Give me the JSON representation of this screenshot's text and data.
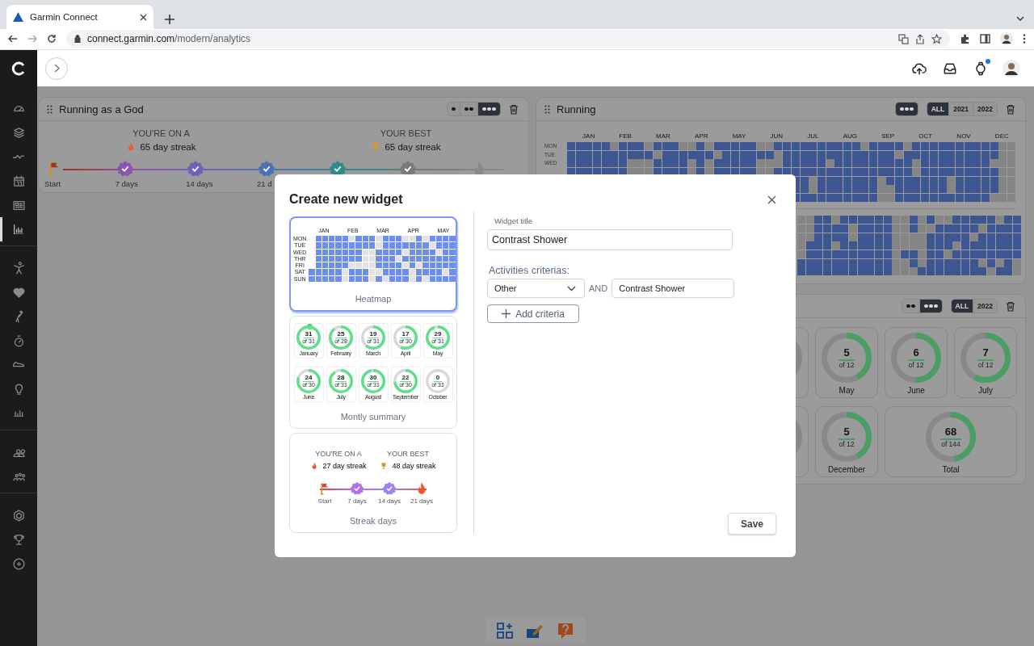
{
  "browser": {
    "tab": {
      "title": "Garmin Connect"
    },
    "url": {
      "host": "connect.garmin.com",
      "path": "/modern/analytics"
    }
  },
  "sidebar": {
    "groups": [
      [
        {
          "kind": "gauge",
          "selected": false
        },
        {
          "kind": "layers",
          "selected": false
        },
        {
          "kind": "pulse",
          "selected": false
        },
        {
          "kind": "calendar",
          "selected": false
        },
        {
          "kind": "news",
          "selected": false
        },
        {
          "kind": "chart",
          "selected": true
        }
      ],
      [
        {
          "kind": "person",
          "selected": false
        },
        {
          "kind": "heart",
          "selected": false
        },
        {
          "kind": "golf",
          "selected": false
        },
        {
          "kind": "stopwatch",
          "selected": false
        },
        {
          "kind": "shoe",
          "selected": false
        },
        {
          "kind": "bulb",
          "selected": false
        },
        {
          "kind": "bars",
          "selected": false
        }
      ],
      [
        {
          "kind": "people",
          "selected": false
        },
        {
          "kind": "group",
          "selected": false
        }
      ],
      [
        {
          "kind": "hexagon",
          "selected": false
        },
        {
          "kind": "trophy",
          "selected": false
        },
        {
          "kind": "target",
          "selected": false
        }
      ]
    ]
  },
  "header": {
    "actions": [
      {
        "kind": "upload",
        "badge": false
      },
      {
        "kind": "inbox",
        "badge": false
      },
      {
        "kind": "watch",
        "badge": true
      },
      {
        "kind": "avatar",
        "badge": false
      }
    ]
  },
  "widgets": [
    {
      "kind": "streak",
      "title": "Running as a God",
      "sizes": [
        {
          "kind": "single",
          "selected": false
        },
        {
          "kind": "double",
          "selected": false
        },
        {
          "kind": "triple",
          "selected": true
        }
      ],
      "current_label": "YOU'RE ON A",
      "current": "65 day streak",
      "best_label": "YOUR BEST",
      "best": "65 day streak",
      "milestones": [
        {
          "kind": "flag",
          "label": "Start",
          "color": "#a8301f"
        },
        {
          "kind": "badge",
          "label": "7 days",
          "color": "#8a55b0"
        },
        {
          "kind": "badge",
          "label": "14 days",
          "color": "#7060b8"
        },
        {
          "kind": "badge",
          "label": "21 d",
          "color": "#4a72b0"
        },
        {
          "kind": "badge",
          "color": "#2f8a8a"
        },
        {
          "kind": "badge",
          "color": "#7a7a7a"
        },
        {
          "kind": "fire",
          "color": "#8a8a8a"
        }
      ]
    },
    {
      "kind": "heatmap",
      "title": "Running",
      "sizes": [
        {
          "kind": "triple",
          "selected": true
        }
      ],
      "years": [
        {
          "label": "ALL",
          "selected": true
        },
        {
          "label": "2021",
          "selected": false
        },
        {
          "label": "2022",
          "selected": false
        }
      ],
      "days": [
        "MON",
        "TUE",
        "WED"
      ],
      "months": [
        "JAN",
        "FEB",
        "MAR",
        "APR",
        "MAY",
        "JUN",
        "JUL",
        "AUG",
        "SEP",
        "OCT",
        "NOV",
        "DEC"
      ],
      "grids": [
        {
          "rows": [
            [
              true,
              true,
              true,
              true,
              true,
              false,
              true,
              true,
              true,
              false,
              true,
              true,
              true,
              false,
              false,
              true,
              false,
              true,
              true,
              true,
              true,
              true,
              false,
              false,
              true,
              true,
              true,
              true,
              true,
              true,
              true,
              true,
              true,
              true,
              false,
              true,
              true,
              true,
              true,
              false,
              true,
              true,
              true,
              true,
              true,
              true,
              true,
              true,
              true,
              true,
              false,
              false
            ],
            [
              true,
              true,
              true,
              true,
              true,
              true,
              true,
              true,
              true,
              true,
              false,
              true,
              true,
              true,
              true,
              true,
              true,
              false,
              true,
              true,
              true,
              true,
              true,
              true,
              false,
              true,
              true,
              true,
              true,
              true,
              true,
              true,
              true,
              true,
              true,
              true,
              true,
              true,
              false,
              true,
              true,
              true,
              true,
              true,
              true,
              true,
              true,
              true,
              true,
              true,
              false,
              false
            ],
            [
              true,
              true,
              true,
              true,
              true,
              true,
              true,
              false,
              false,
              false,
              true,
              true,
              true,
              true,
              false,
              true,
              false,
              true,
              true,
              true,
              true,
              true,
              false,
              false,
              false,
              true,
              true,
              true,
              true,
              true,
              false,
              true,
              true,
              true,
              true,
              true,
              true,
              true,
              true,
              true,
              false,
              true,
              true,
              true,
              true,
              true,
              true,
              true,
              true,
              false,
              false,
              false
            ],
            [
              true,
              true,
              true,
              true,
              true,
              true,
              true,
              false,
              false,
              false,
              true,
              true,
              true,
              true,
              false,
              true,
              false,
              true,
              true,
              true,
              true,
              true,
              false,
              false,
              true,
              true,
              true,
              true,
              true,
              true,
              true,
              true,
              true,
              true,
              true,
              true,
              true,
              true,
              true,
              true,
              false,
              true,
              true,
              true,
              true,
              true,
              true,
              true,
              true,
              true,
              false,
              false
            ],
            [
              true,
              true,
              false,
              true,
              true,
              true,
              true,
              true,
              true,
              true,
              false,
              true,
              true,
              true,
              true,
              true,
              true,
              true,
              false,
              true,
              true,
              true,
              true,
              true,
              false,
              false
            ],
            [
              true,
              true,
              false,
              true,
              true,
              true,
              true,
              true,
              true,
              true,
              false,
              false,
              true,
              true,
              true,
              true,
              true,
              true,
              false,
              true,
              true,
              true,
              true,
              true,
              false,
              false
            ],
            [
              true,
              true,
              true,
              true,
              true,
              true,
              true,
              true,
              true,
              true,
              false,
              false,
              true,
              true,
              true,
              true,
              true,
              true,
              true,
              true,
              true,
              true,
              true,
              false,
              false,
              false
            ]
          ]
        },
        {
          "rows": [
            [
              false,
              false,
              true,
              true,
              false,
              true,
              true,
              true,
              true,
              true,
              true,
              false,
              false,
              true,
              false,
              true,
              false,
              false,
              true,
              true,
              true,
              true,
              true,
              false,
              true,
              true
            ],
            [
              false,
              false,
              true,
              true,
              true,
              true,
              false,
              true,
              true,
              true,
              true,
              false,
              false,
              true,
              false,
              false,
              true,
              true,
              true,
              true,
              true,
              false,
              true,
              true,
              true,
              true
            ],
            [
              false,
              false,
              true,
              true,
              true,
              true,
              false,
              true,
              true,
              true,
              true,
              false,
              false,
              false,
              false,
              true,
              true,
              true,
              true,
              true,
              false,
              true,
              true,
              true,
              true,
              true
            ],
            [
              false,
              true,
              true,
              true,
              false,
              true,
              true,
              true,
              true,
              true,
              true,
              false,
              false,
              false,
              false,
              true,
              true,
              true,
              false,
              true,
              true,
              true,
              true,
              true,
              true,
              true
            ],
            [
              false,
              true,
              true,
              true,
              true,
              true,
              true,
              true,
              true,
              true,
              true,
              false,
              true,
              true,
              false,
              true,
              true,
              false,
              true,
              true,
              true,
              true,
              true,
              true,
              true,
              true
            ],
            [
              true,
              true,
              true,
              true,
              true,
              true,
              true,
              true,
              true,
              true,
              true,
              false,
              false,
              true,
              false,
              true,
              true,
              true,
              true,
              true,
              true,
              false,
              true,
              false,
              true,
              false
            ],
            [
              true,
              true,
              true,
              true,
              true,
              true,
              true,
              true,
              true,
              true,
              true,
              false,
              false,
              false,
              true,
              true,
              true,
              true,
              true,
              true,
              true,
              true,
              false,
              true,
              true,
              false
            ]
          ]
        }
      ]
    },
    {
      "kind": "monthly",
      "sizes": [
        {
          "kind": "double",
          "selected": false
        },
        {
          "kind": "triple",
          "selected": true
        }
      ],
      "years": [
        {
          "label": "ALL",
          "selected": true
        },
        {
          "label": "2022",
          "selected": false
        }
      ],
      "rows": [
        [
          {
            "kind": "month"
          },
          {
            "kind": "month",
            "value": "5",
            "total": "of 12",
            "label": "May",
            "level": 0.42
          },
          {
            "kind": "month",
            "value": "6",
            "total": "of 12",
            "label": "June",
            "level": 0.5
          },
          {
            "kind": "month",
            "value": "7",
            "total": "of 12",
            "label": "July",
            "level": 0.58
          }
        ],
        [
          {
            "kind": "month"
          },
          {
            "kind": "month",
            "value": "5",
            "total": "of 12",
            "label": "December",
            "level": 0.42
          },
          {
            "kind": "total",
            "value": "68",
            "total": "of 144",
            "label": "Total",
            "level": 0.47
          }
        ]
      ]
    }
  ],
  "modal": {
    "title": "Create new widget",
    "templates": [
      {
        "kind": "heatmap",
        "label": "Heatmap",
        "selected": true,
        "days": [
          "MON",
          "TUE",
          "WED",
          "THR",
          "FRI",
          "SAT",
          "SUN"
        ],
        "months": [
          "JAN",
          "FEB",
          "MAR",
          "APR",
          "MAY"
        ],
        "rows": [
          [
            null,
            true,
            true,
            true,
            true,
            true,
            false,
            true,
            true,
            true,
            false,
            true,
            true,
            true,
            false,
            false,
            true,
            false,
            true,
            true,
            true,
            true
          ],
          [
            null,
            true,
            true,
            true,
            true,
            true,
            true,
            true,
            true,
            true,
            false,
            true,
            true,
            true,
            true,
            true,
            true,
            true,
            false,
            true,
            true,
            true
          ],
          [
            null,
            true,
            true,
            true,
            true,
            true,
            true,
            true,
            false,
            false,
            true,
            true,
            true,
            true,
            false,
            true,
            true,
            true,
            true,
            false,
            true,
            true
          ],
          [
            null,
            true,
            true,
            true,
            true,
            true,
            true,
            true,
            false,
            false,
            true,
            true,
            true,
            false,
            true,
            true,
            true,
            true,
            true,
            true,
            true,
            true
          ],
          [
            null,
            true,
            true,
            true,
            true,
            true,
            false,
            false,
            false,
            false,
            true,
            true,
            true,
            true,
            false,
            true,
            false,
            true,
            true,
            true,
            true,
            true
          ],
          [
            true,
            true,
            true,
            true,
            true,
            false,
            true,
            true,
            true,
            false,
            false,
            true,
            true,
            true,
            true,
            false,
            true,
            true,
            true,
            true,
            false,
            true
          ],
          [
            true,
            true,
            true,
            true,
            true,
            false,
            true,
            true,
            true,
            false,
            true,
            false,
            true,
            true,
            true,
            false,
            true,
            false,
            true,
            true,
            true,
            true
          ]
        ]
      },
      {
        "kind": "monthly",
        "label": "Montly summary",
        "selected": false,
        "cards": [
          {
            "value": "31",
            "total": "of 31",
            "label": "January",
            "level": 1,
            "done": true
          },
          {
            "value": "25",
            "total": "of 28",
            "label": "February",
            "level": 0.89,
            "done": false
          },
          {
            "value": "19",
            "total": "of 31",
            "label": "March",
            "level": 0.61,
            "done": false
          },
          {
            "value": "17",
            "total": "of 30",
            "label": "April",
            "level": 0.57,
            "done": false
          },
          {
            "value": "29",
            "total": "of 31",
            "label": "May",
            "level": 0.94,
            "done": false
          },
          {
            "value": "24",
            "total": "of 30",
            "label": "June",
            "level": 0.8,
            "done": false
          },
          {
            "value": "28",
            "total": "of 31",
            "label": "July",
            "level": 0.9,
            "done": false
          },
          {
            "value": "30",
            "total": "of 31",
            "label": "August",
            "level": 0.97,
            "done": false
          },
          {
            "value": "22",
            "total": "of 30",
            "label": "September",
            "level": 0.73,
            "done": false
          },
          {
            "value": "0",
            "total": "of 31",
            "label": "October",
            "level": 0,
            "done": false
          }
        ]
      },
      {
        "kind": "streak",
        "label": "Streak days",
        "selected": false,
        "current_label": "YOU'RE ON A",
        "current": "27 day streak",
        "best_label": "YOUR BEST",
        "best": "48 day streak",
        "milestones": [
          {
            "kind": "flag",
            "label": "Start",
            "color": "#e2452f"
          },
          {
            "kind": "badge",
            "label": "7 days",
            "color": "#b173e6"
          },
          {
            "kind": "badge",
            "label": "14 days",
            "color": "#9a85f0"
          },
          {
            "kind": "fire",
            "label": "21 days",
            "color": "#f0582c"
          }
        ]
      }
    ],
    "title_field": {
      "label": "Widget title",
      "value": "Contrast Shower"
    },
    "criteria_label": "Activities criterias:",
    "criteria": [
      {
        "type": "Other",
        "join": "AND",
        "value": "Contrast Shower"
      }
    ],
    "add_button": "Add criteria",
    "save_button": "Save"
  },
  "toolbar": [
    {
      "kind": "widgets"
    },
    {
      "kind": "edit"
    },
    {
      "kind": "help"
    }
  ]
}
